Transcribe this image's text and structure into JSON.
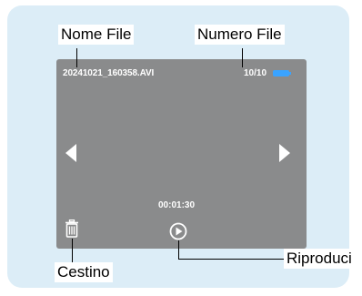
{
  "labels": {
    "file_name": "Nome File",
    "file_number": "Numero File",
    "trash": "Cestino",
    "play": "Riproduci"
  },
  "screen": {
    "file_name_value": "20241021_160358.AVI",
    "file_counter": "10/10",
    "time_display": "00:01:30"
  },
  "icons": {
    "prev": "arrow-left-icon",
    "next": "arrow-right-icon",
    "trash": "trash-icon",
    "play": "play-circle-icon",
    "battery": "battery-icon"
  },
  "colors": {
    "panel": "#dcedf7",
    "screen": "#8a8b8c",
    "battery": "#3aa3ff"
  }
}
